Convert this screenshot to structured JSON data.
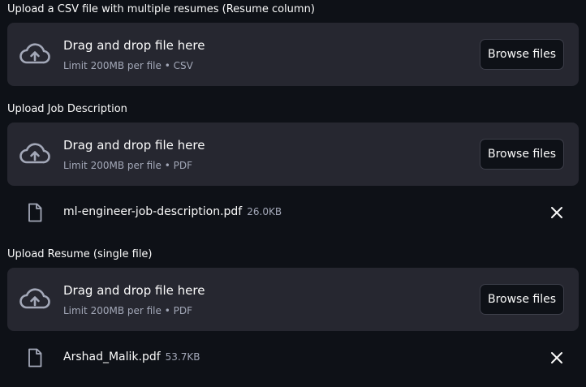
{
  "uploaders": [
    {
      "label": "Upload a CSV file with multiple resumes (Resume column)",
      "dropzone_title": "Drag and drop file here",
      "dropzone_limit": "Limit 200MB per file • CSV",
      "browse_label": "Browse files",
      "file": null
    },
    {
      "label": "Upload Job Description",
      "dropzone_title": "Drag and drop file here",
      "dropzone_limit": "Limit 200MB per file • PDF",
      "browse_label": "Browse files",
      "file": {
        "name": "ml-engineer-job-description.pdf",
        "size": "26.0KB"
      }
    },
    {
      "label": "Upload Resume (single file)",
      "dropzone_title": "Drag and drop file here",
      "dropzone_limit": "Limit 200MB per file • PDF",
      "browse_label": "Browse files",
      "file": {
        "name": "Arshad_Malik.pdf",
        "size": "53.7KB"
      }
    }
  ],
  "icons": {
    "upload": "cloud-upload-icon",
    "file": "file-icon",
    "remove": "close-icon"
  },
  "colors": {
    "background": "#0e1117",
    "dropzone": "#262730",
    "muted_text": "#a3a8b8"
  }
}
